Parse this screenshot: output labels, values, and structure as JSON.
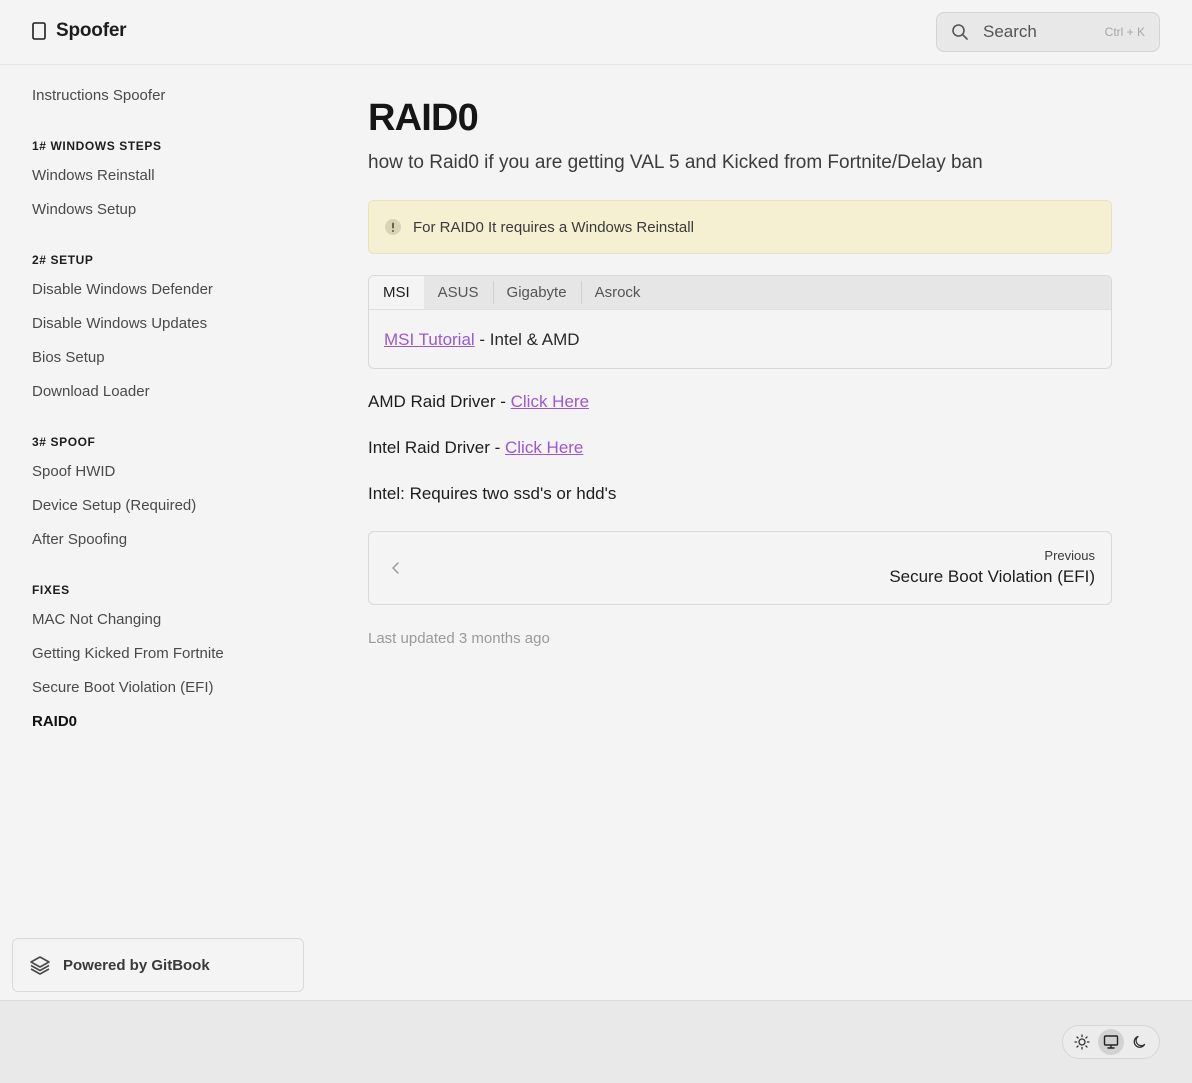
{
  "header": {
    "brand_title": "Spoofer",
    "search_placeholder": "Search",
    "search_shortcut": "Ctrl + K"
  },
  "sidebar": {
    "top_link": "Instructions Spoofer",
    "sections": [
      {
        "heading": "1# WINDOWS STEPS",
        "items": [
          "Windows Reinstall",
          "Windows Setup"
        ]
      },
      {
        "heading": "2# SETUP",
        "items": [
          "Disable Windows Defender",
          "Disable Windows Updates",
          "Bios Setup",
          "Download Loader"
        ]
      },
      {
        "heading": "3# SPOOF",
        "items": [
          "Spoof HWID",
          "Device Setup (Required)",
          "After Spoofing"
        ]
      },
      {
        "heading": "FIXES",
        "items": [
          "MAC Not Changing",
          "Getting Kicked From Fortnite",
          "Secure Boot Violation (EFI)",
          "RAID0"
        ]
      }
    ],
    "active_item": "RAID0",
    "powered_by": "Powered by GitBook"
  },
  "main": {
    "title": "RAID0",
    "subtitle": "how to Raid0 if you are getting VAL 5 and Kicked from Fortnite/Delay ban",
    "hint": "For RAID0 It requires a Windows Reinstall",
    "tabs": [
      "MSI",
      "ASUS",
      "Gigabyte",
      "Asrock"
    ],
    "active_tab": "MSI",
    "tab_content": {
      "link_text": "MSI Tutorial",
      "suffix": " - Intel & AMD"
    },
    "amd_driver": {
      "label": "AMD Raid Driver - ",
      "link": "Click Here"
    },
    "intel_driver": {
      "label": "Intel Raid Driver - ",
      "link": "Click Here"
    },
    "intel_note": "Intel: Requires two ssd's or hdd's",
    "previous": {
      "label": "Previous",
      "title": "Secure Boot Violation (EFI)"
    },
    "last_updated": "Last updated 3 months ago"
  },
  "footer": {
    "theme_options": [
      "light",
      "system",
      "dark"
    ],
    "active_theme": "system"
  }
}
